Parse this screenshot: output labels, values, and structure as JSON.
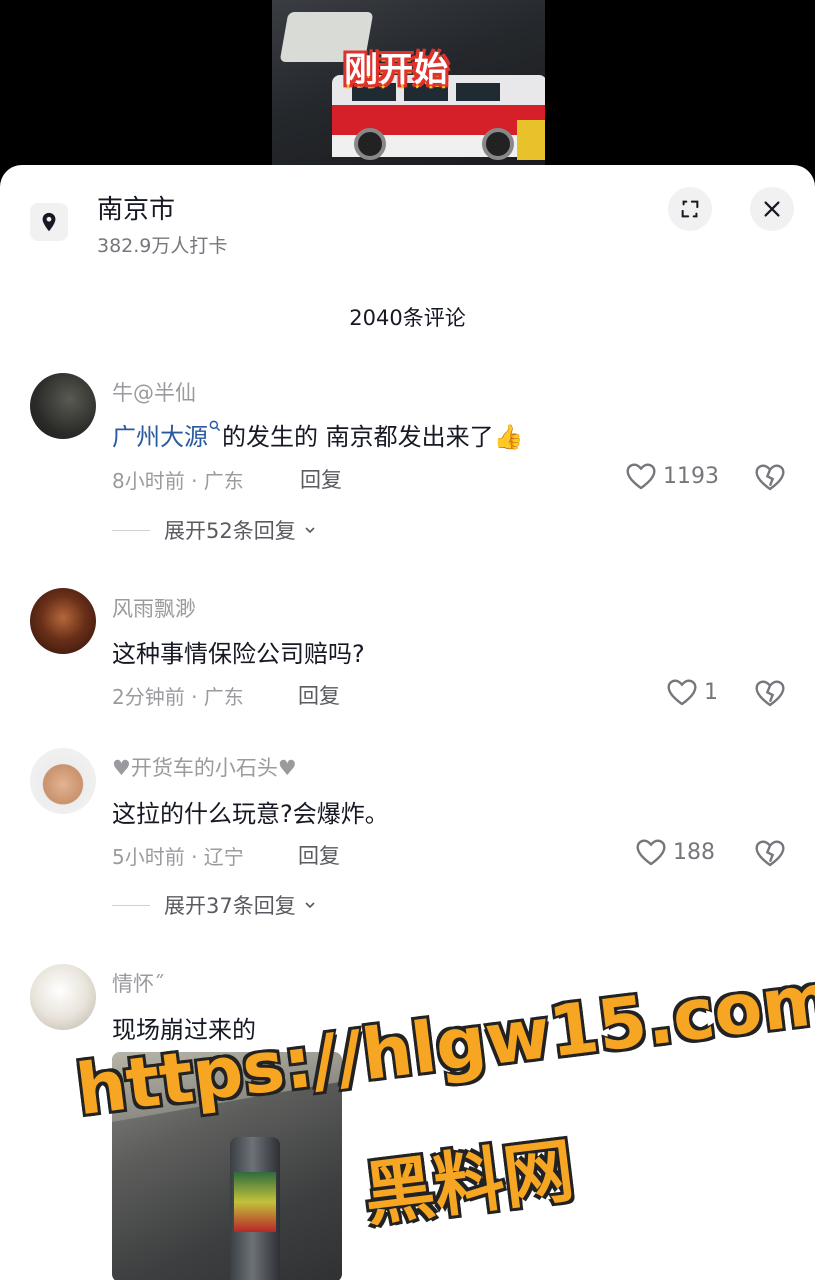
{
  "video": {
    "title_text": "刚开始"
  },
  "location": {
    "name": "南京市",
    "checkins": "382.9万人打卡"
  },
  "comment_count": "2040条评论",
  "comments": [
    {
      "username": "牛@半仙",
      "link_text": "广州大源",
      "text": "的发生的 南京都发出来了",
      "emoji": "👍",
      "time_place": "8小时前 · 广东",
      "reply_label": "回复",
      "likes": "1193",
      "expand_label": "展开52条回复"
    },
    {
      "username": "风雨飘渺",
      "text": "这种事情保险公司赔吗?",
      "time_place": "2分钟前 · 广东",
      "reply_label": "回复",
      "likes": "1"
    },
    {
      "username": "♥开货车的小石头♥",
      "text": "这拉的什么玩意?会爆炸。",
      "time_place": "5小时前 · 辽宁",
      "reply_label": "回复",
      "likes": "188",
      "expand_label": "展开37条回复"
    },
    {
      "username": "情怀˝",
      "text": "现场崩过来的"
    }
  ],
  "watermark": {
    "url": "https://hlgw15.com",
    "site": "黑料网"
  },
  "icons": [
    "location-pin-icon",
    "expand-icon",
    "close-icon",
    "heart-icon",
    "broken-heart-icon",
    "search-icon",
    "chevron-down-icon"
  ]
}
